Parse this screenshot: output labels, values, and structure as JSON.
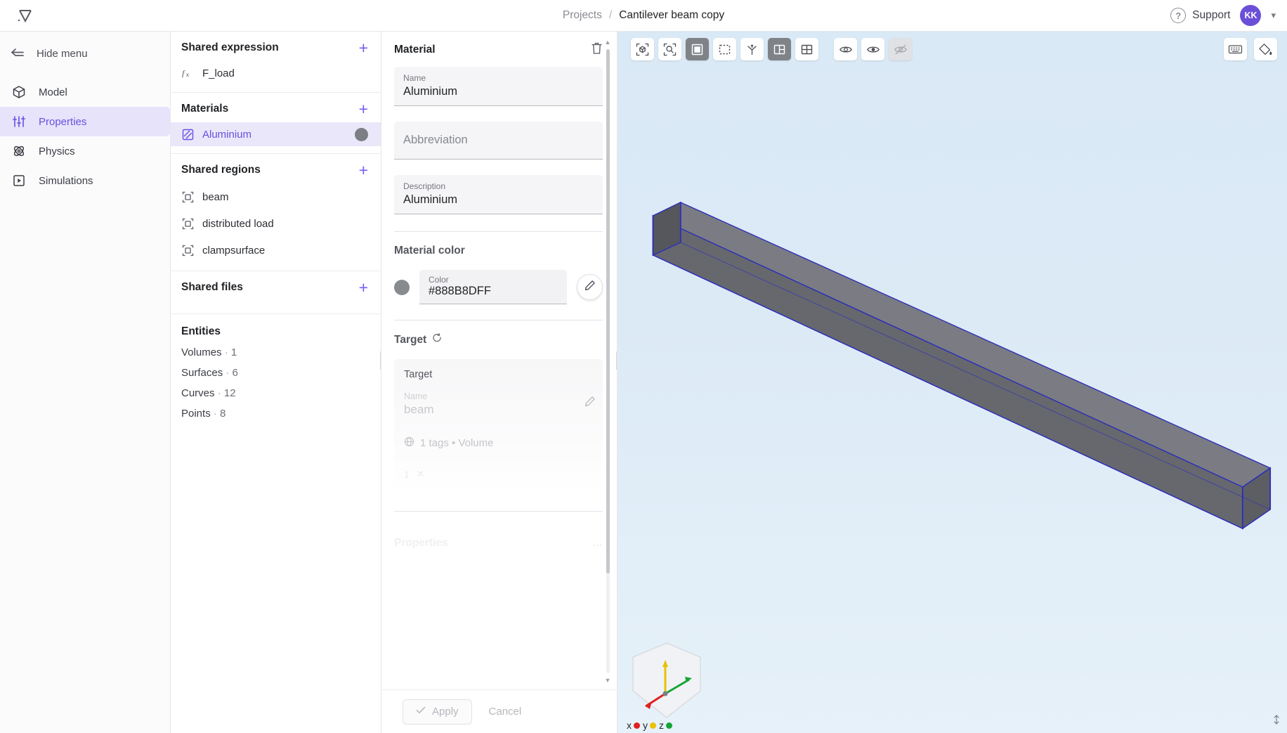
{
  "header": {
    "logo_icon": "vector-logo-icon",
    "breadcrumb": {
      "root": "Projects",
      "separator": "/",
      "current": "Cantilever beam copy"
    },
    "support_label": "Support",
    "support_icon": "help-circle-icon",
    "avatar_initials": "KK",
    "avatar_chevron_icon": "chevron-down-icon",
    "accent_color": "#6c4fd8"
  },
  "leftnav": {
    "hide_menu_label": "Hide menu",
    "hide_menu_icon": "collapse-left-icon",
    "items": [
      {
        "label": "Model",
        "icon": "cube-icon",
        "active": false
      },
      {
        "label": "Properties",
        "icon": "sliders-icon",
        "active": true
      },
      {
        "label": "Physics",
        "icon": "atom-icon",
        "active": false
      },
      {
        "label": "Simulations",
        "icon": "play-square-icon",
        "active": false
      }
    ]
  },
  "listpanel": {
    "sections": [
      {
        "title": "Shared expression",
        "add_icon": "plus-icon",
        "rows": [
          {
            "label": "F_load",
            "icon": "function-fx-icon",
            "selected": false
          }
        ]
      },
      {
        "title": "Materials",
        "add_icon": "plus-icon",
        "rows": [
          {
            "label": "Aluminium",
            "icon": "material-hatch-icon",
            "selected": true,
            "swatch": "#7c7e85"
          }
        ]
      },
      {
        "title": "Shared regions",
        "add_icon": "plus-icon",
        "rows": [
          {
            "label": "beam",
            "icon": "region-icon",
            "selected": false
          },
          {
            "label": "distributed load",
            "icon": "region-icon",
            "selected": false
          },
          {
            "label": "clampsurface",
            "icon": "region-icon",
            "selected": false
          }
        ]
      },
      {
        "title": "Shared files",
        "add_icon": "plus-icon",
        "rows": []
      }
    ],
    "entities": {
      "title": "Entities",
      "rows": [
        {
          "label": "Volumes",
          "sep": "·",
          "count": "1"
        },
        {
          "label": "Surfaces",
          "sep": "·",
          "count": "6"
        },
        {
          "label": "Curves",
          "sep": "·",
          "count": "12"
        },
        {
          "label": "Points",
          "sep": "·",
          "count": "8"
        }
      ]
    }
  },
  "detail": {
    "title": "Material",
    "delete_icon": "trash-icon",
    "fields": [
      {
        "label": "Name",
        "value": "Aluminium",
        "placeholder": ""
      },
      {
        "label": "",
        "value": "",
        "placeholder": "Abbreviation"
      },
      {
        "label": "Description",
        "value": "Aluminium",
        "placeholder": ""
      }
    ],
    "material_color": {
      "section_label": "Material color",
      "swatch_hex": "#888b8d",
      "field_label": "Color",
      "field_value": "#888B8DFF",
      "edit_icon": "pencil-icon"
    },
    "target": {
      "section_label": "Target",
      "refresh_icon": "refresh-icon",
      "card_title": "Target",
      "name_label": "Name",
      "name_value": "beam",
      "tags_icon": "globe-icon",
      "tags_text": "1 tags • Volume",
      "count_value": "1",
      "remove_icon": "x-icon",
      "edit_icon": "pencil-icon"
    },
    "properties_section_label": "Properties",
    "footer": {
      "apply_label": "Apply",
      "apply_icon": "check-icon",
      "cancel_label": "Cancel"
    },
    "scrollbar": {
      "up_icon": "caret-up-icon",
      "down_icon": "caret-down-icon"
    }
  },
  "viewport": {
    "toolbar_left": [
      {
        "icon": "fit-to-object-icon",
        "state": "normal"
      },
      {
        "icon": "zoom-to-region-icon",
        "state": "normal"
      },
      {
        "icon": "select-solid-icon",
        "state": "selected"
      },
      {
        "icon": "select-box-icon",
        "state": "normal"
      },
      {
        "icon": "axis-move-icon",
        "state": "normal"
      },
      {
        "icon": "grid-split-icon",
        "state": "selected"
      },
      {
        "icon": "grid-quad-icon",
        "state": "normal"
      },
      {
        "icon": "eye-icon",
        "state": "normal"
      },
      {
        "icon": "eye-alt-icon",
        "state": "normal"
      },
      {
        "icon": "eye-off-icon",
        "state": "disabled"
      }
    ],
    "toolbar_right": [
      {
        "icon": "keyboard-icon",
        "state": "normal"
      },
      {
        "icon": "paint-bucket-icon",
        "state": "normal"
      }
    ],
    "model": {
      "name": "cantilever-beam",
      "body_color": "#6f7077",
      "edge_color": "#2d2fb8"
    },
    "axis_gizmo": {
      "labels": [
        {
          "axis": "x",
          "color": "#e02020"
        },
        {
          "axis": "y",
          "color": "#e8c200"
        },
        {
          "axis": "z",
          "color": "#17a437"
        }
      ]
    },
    "corner_icon": "resize-handle-icon",
    "background_top": "#d9e9f5",
    "background_bottom": "#e6f1f9"
  }
}
